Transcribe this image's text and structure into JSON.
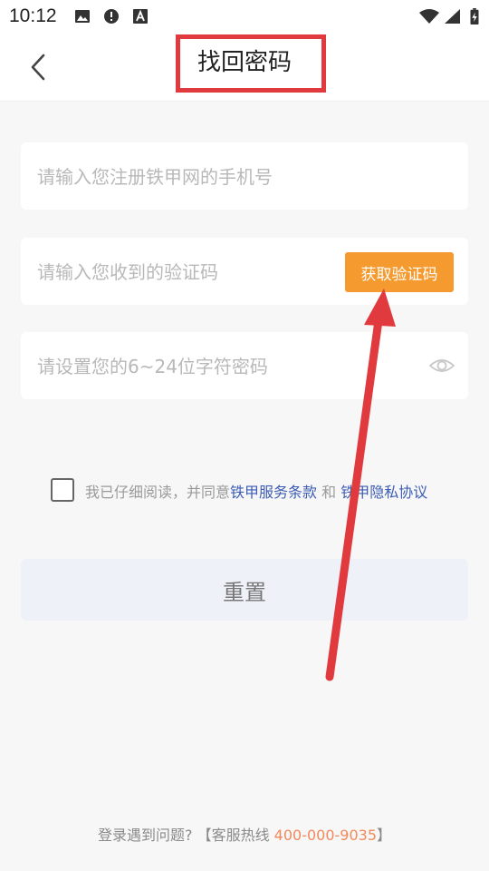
{
  "status_bar": {
    "time": "10:12",
    "left_icons": [
      "image-icon",
      "alert-circle-icon",
      "text-a-icon"
    ],
    "right_icons": [
      "wifi-icon",
      "signal-icon",
      "battery-charging-icon"
    ]
  },
  "header": {
    "title": "找回密码",
    "back_icon": "chevron-left-icon"
  },
  "form": {
    "phone": {
      "value": "",
      "placeholder": "请输入您注册铁甲网的手机号"
    },
    "code": {
      "value": "",
      "placeholder": "请输入您收到的验证码",
      "button_label": "获取验证码"
    },
    "password": {
      "value": "",
      "placeholder": "请设置您的6~24位字符密码",
      "toggle_icon": "eye-icon"
    }
  },
  "agreement": {
    "checked": false,
    "prefix": "我已仔细阅读，并同意",
    "terms_label": "铁甲服务条款",
    "and": " 和 ",
    "privacy_label": "铁甲隐私协议"
  },
  "reset_button_label": "重置",
  "footer": {
    "prefix": "登录遇到问题? 【客服热线 ",
    "hotline": "400-000-9035",
    "suffix": "】"
  },
  "colors": {
    "accent_orange": "#f59a2e",
    "link_blue": "#3c5db3",
    "hotline_orange": "#f08a5d",
    "annotation_red": "#e03a3e"
  }
}
